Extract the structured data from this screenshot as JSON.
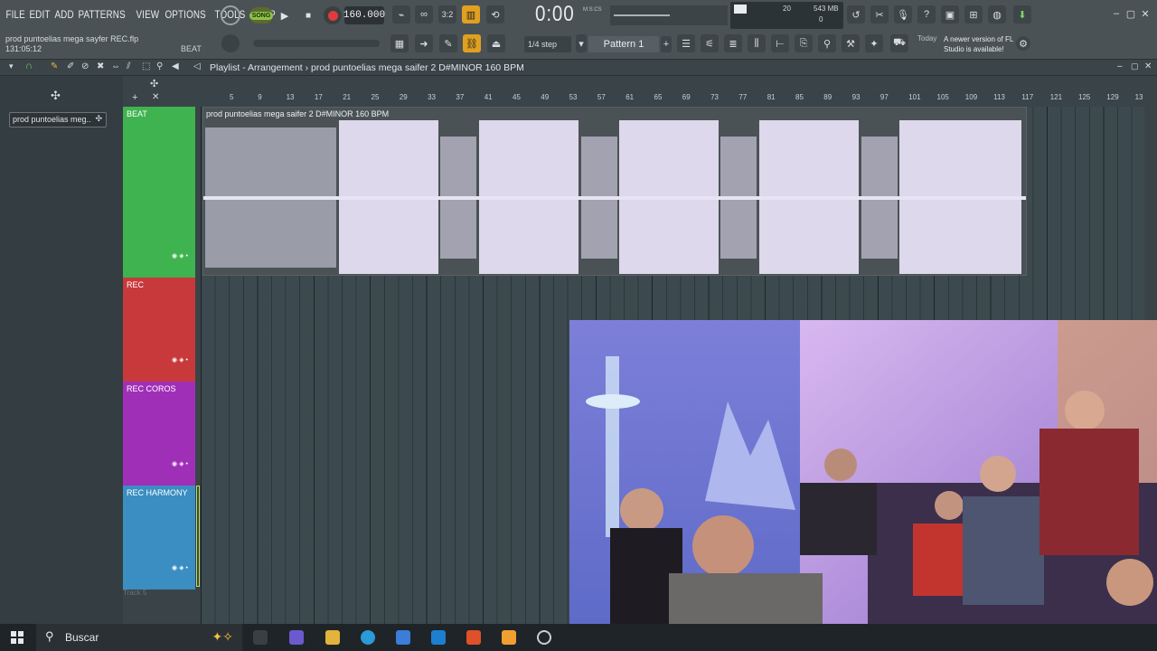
{
  "menu": [
    "FILE",
    "EDIT",
    "ADD",
    "PATTERNS",
    "VIEW",
    "OPTIONS",
    "TOOLS",
    "HELP"
  ],
  "project": {
    "filename": "prod puntoelias mega sayfer REC.flp",
    "position": "131:05:12",
    "channel": "BEAT"
  },
  "transport": {
    "song_label": "SONG",
    "tempo": "160.000",
    "time": "0:00",
    "time_unit": "M:S:CS"
  },
  "cpu": {
    "value1": "20",
    "memory": "543 MB",
    "value2": "0"
  },
  "step": "1/4 step",
  "pattern": "Pattern 1",
  "news": {
    "date": "Today",
    "text": "A newer version of FL Studio is available!"
  },
  "playlist": {
    "title": "Playlist - Arrangement › prod puntoelias mega saifer 2 D#MINOR 160 BPM"
  },
  "sidebar_pattern": "prod puntoelias meg..",
  "ruler": [
    "5",
    "9",
    "13",
    "17",
    "21",
    "25",
    "29",
    "33",
    "37",
    "41",
    "45",
    "49",
    "53",
    "57",
    "61",
    "65",
    "69",
    "73",
    "77",
    "81",
    "85",
    "89",
    "93",
    "97",
    "101",
    "105",
    "109",
    "113",
    "117",
    "121",
    "125",
    "129",
    "13"
  ],
  "tracks": [
    {
      "name": "BEAT",
      "color": "#3fb34f"
    },
    {
      "name": "REC",
      "color": "#c8393c"
    },
    {
      "name": "REC COROS",
      "color": "#a02fb8"
    },
    {
      "name": "REC HARMONY",
      "color": "#3a8ec2"
    }
  ],
  "track5": "Track 5",
  "clip_label": "prod puntoelias mega saifer 2 D#MINOR 160 BPM",
  "taskbar": {
    "search": "Buscar"
  }
}
